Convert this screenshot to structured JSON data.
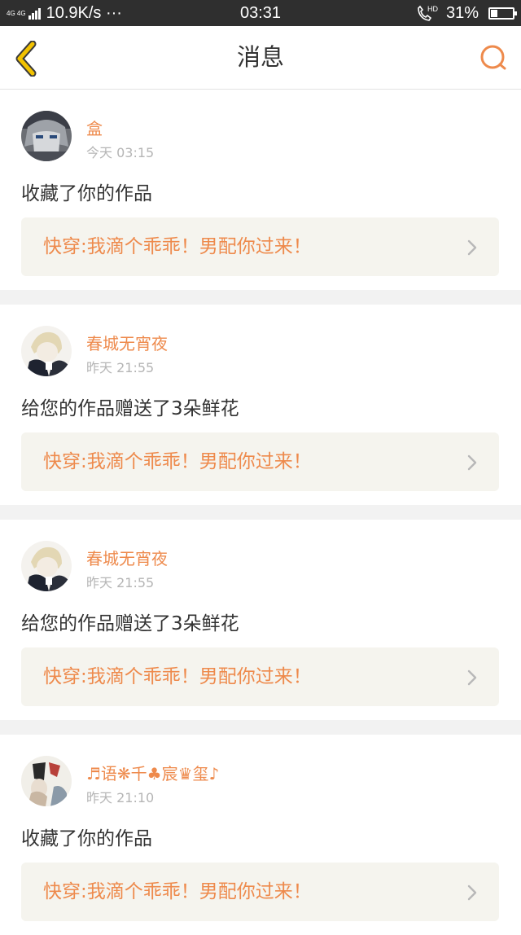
{
  "status_bar": {
    "network": "4G 4G",
    "speed": "10.9K/s ···",
    "time": "03:31",
    "hd": "HD",
    "battery_text": "31%",
    "battery_level": 0.31
  },
  "header": {
    "title": "消息",
    "back_icon": "chevron-left-icon",
    "search_icon": "search-icon"
  },
  "colors": {
    "accent": "#ee8a4c",
    "back_icon": "#f2c200",
    "link_bg": "#f5f4ee",
    "divider": "#f2f2f2"
  },
  "messages": [
    {
      "user": "盒",
      "time": "今天 03:15",
      "text": "收藏了你的作品",
      "work_title": "快穿:我滴个乖乖！男配你过来！"
    },
    {
      "user": "春城无宵夜",
      "time": "昨天 21:55",
      "text": "给您的作品赠送了3朵鲜花",
      "work_title": "快穿:我滴个乖乖！男配你过来！"
    },
    {
      "user": "春城无宵夜",
      "time": "昨天 21:55",
      "text": "给您的作品赠送了3朵鲜花",
      "work_title": "快穿:我滴个乖乖！男配你过来！"
    },
    {
      "user": "♬语❋千♣宸♛玺♪",
      "time": "昨天 21:10",
      "text": "收藏了你的作品",
      "work_title": "快穿:我滴个乖乖！男配你过来！"
    }
  ]
}
